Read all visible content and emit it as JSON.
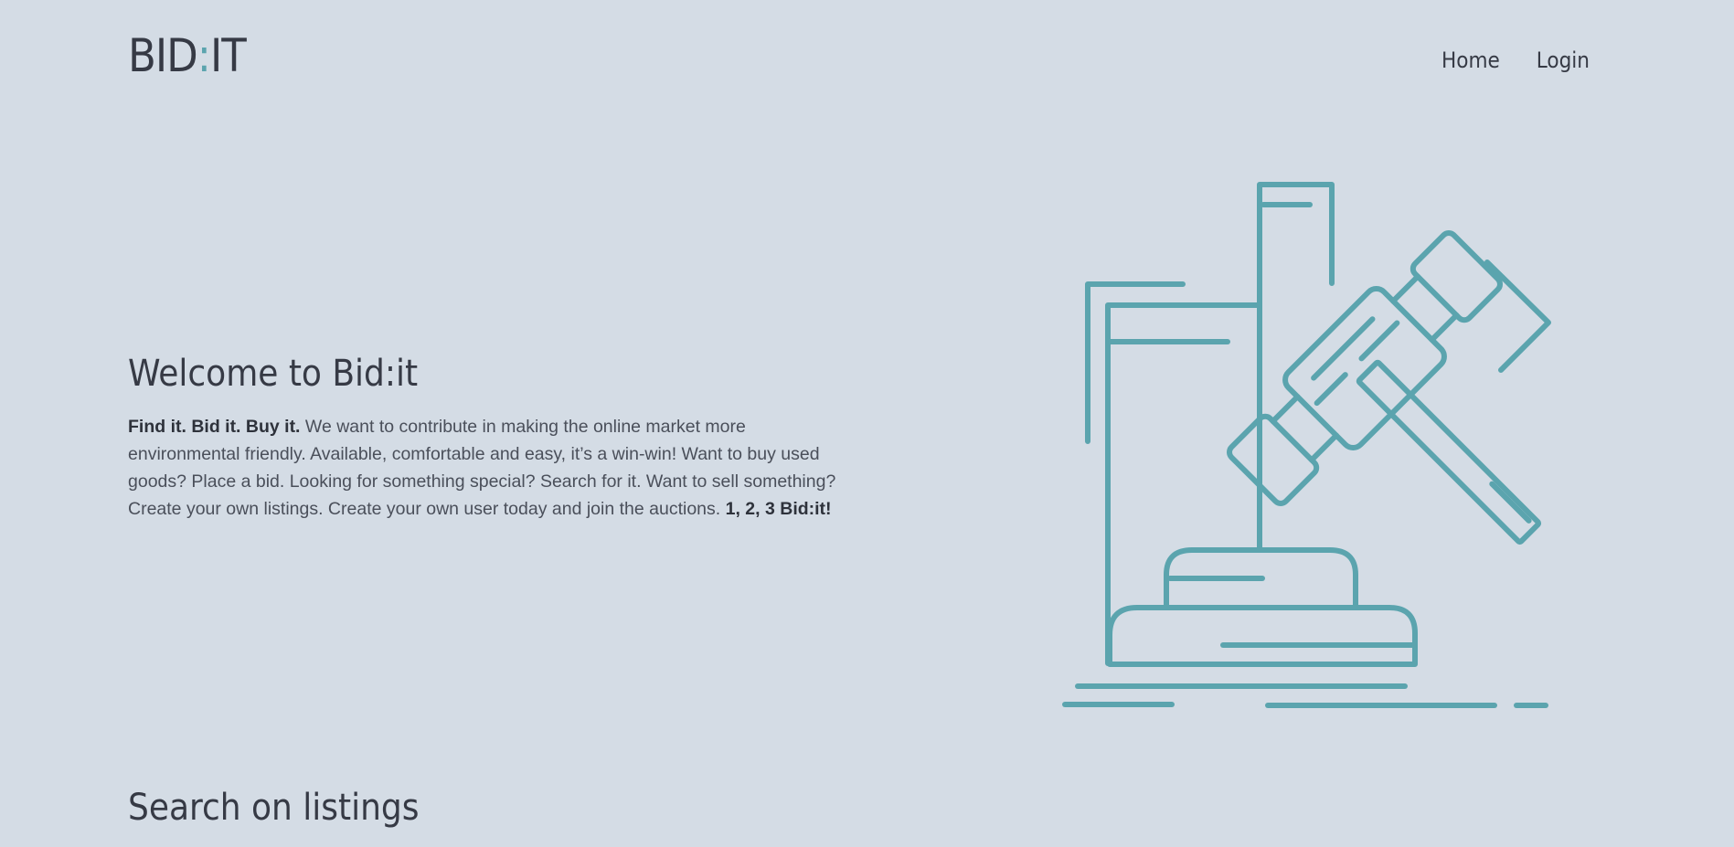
{
  "header": {
    "logo_part1": "BID",
    "logo_colon": ":",
    "logo_part2": "IT",
    "nav": {
      "home": "Home",
      "login": "Login"
    }
  },
  "hero": {
    "title": "Welcome to Bid:it",
    "lead_bold": "Find it. Bid it. Buy it.",
    "body": " We want to contribute in making the online market more environmental friendly. Available, comfortable and easy, it’s a win-win! Want to buy used goods? Place a bid. Looking for something special? Search for it. Want to sell something? Create your own listings. Create your own user today and join the auctions. ",
    "closing_bold": "1, 2, 3 Bid:it!",
    "illustration": "gavel-icon"
  },
  "search_section": {
    "title": "Search on listings"
  },
  "colors": {
    "background": "#d4dce5",
    "text": "#363a45",
    "accent": "#5ba4ae"
  }
}
